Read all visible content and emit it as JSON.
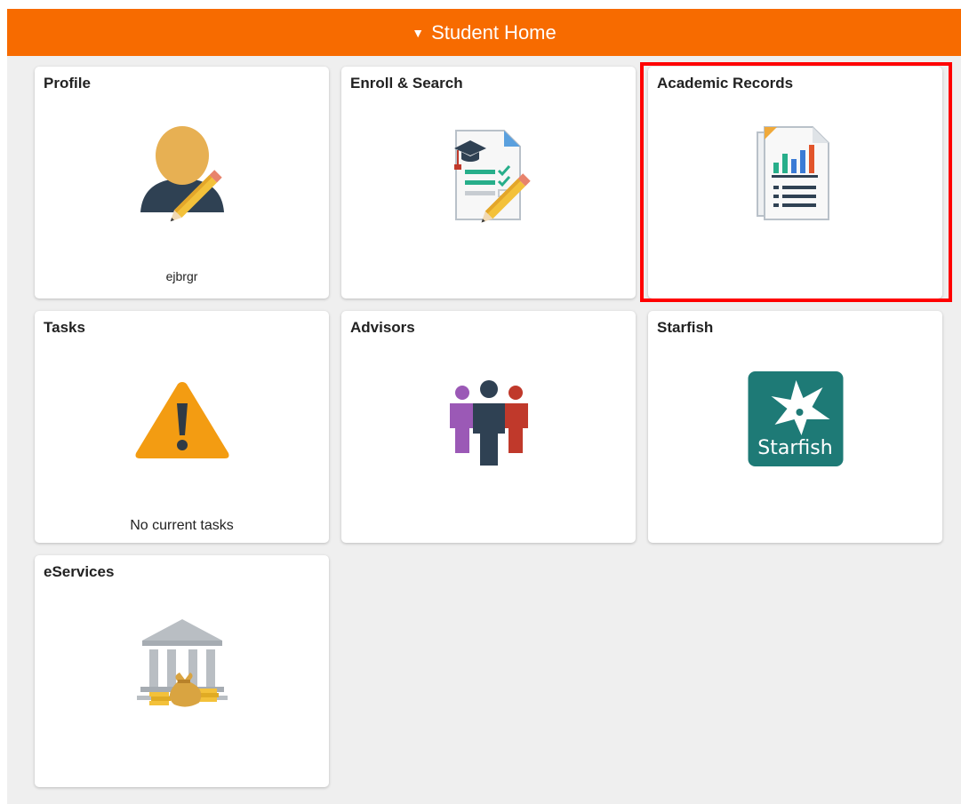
{
  "header": {
    "title": "Student Home",
    "caret": "▼"
  },
  "tiles": [
    {
      "title": "Profile",
      "icon": "profile-edit-icon",
      "caption": "ejbrgr"
    },
    {
      "title": "Enroll & Search",
      "icon": "enrollment-document-icon"
    },
    {
      "title": "Academic Records",
      "icon": "academic-records-report-icon"
    },
    {
      "title": "Tasks",
      "icon": "warning-icon",
      "caption": "No current tasks"
    },
    {
      "title": "Advisors",
      "icon": "advisors-people-icon"
    },
    {
      "title": "Starfish",
      "icon": "starfish-logo-icon",
      "logo_text": "Starfish"
    },
    {
      "title": "eServices",
      "icon": "bank-money-icon"
    }
  ],
  "colors": {
    "header": "#f76b00",
    "highlight": "#ff0000",
    "background": "#efefef",
    "starfish": "#1e7a76"
  }
}
